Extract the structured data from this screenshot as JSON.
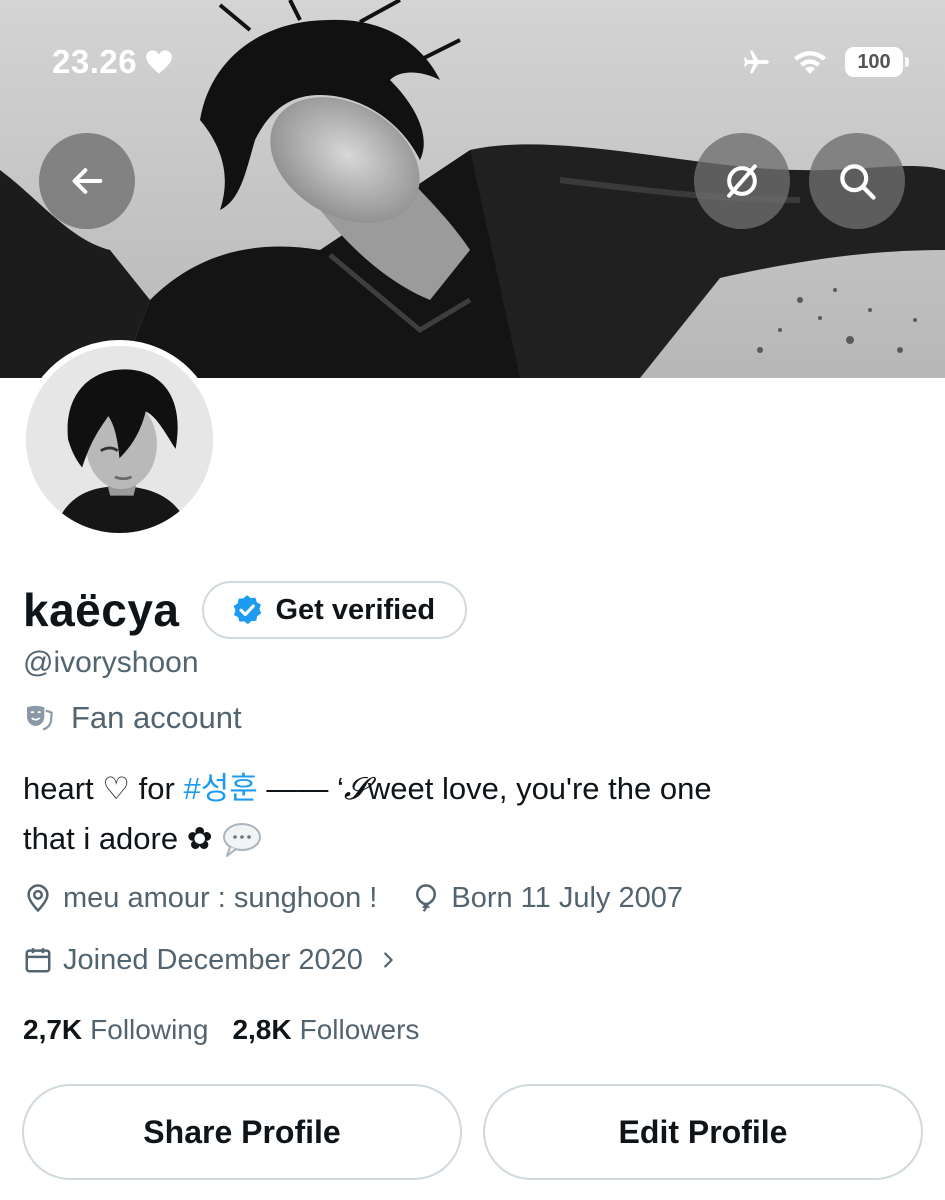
{
  "status_bar": {
    "time": "23.26",
    "heart_icon": "heart-icon",
    "airplane_icon": "airplane-icon",
    "wifi_icon": "wifi-icon",
    "battery_level": "100"
  },
  "header": {
    "back_icon": "arrow-left-icon",
    "translate_icon": "translate-slash-icon",
    "search_icon": "search-icon"
  },
  "profile": {
    "display_name": "kaëcya",
    "verify_label": "Get verified",
    "handle": "@ivoryshoon",
    "category": "Fan account",
    "bio": {
      "part1": "heart ♡ for ",
      "hashtag": "#성훈",
      "part2": " —— ‘",
      "script_letter": "𝓢",
      "part3": "weet love, you're the one that i adore ✿ ",
      "speech_icon": "speech-bubble-icon"
    },
    "location": "meu amour  :  sunghoon !",
    "birthday": "Born 11 July 2007",
    "joined": "Joined December 2020",
    "following_count": "2,7K",
    "following_label": "Following",
    "followers_count": "2,8K",
    "followers_label": "Followers"
  },
  "actions": {
    "share_label": "Share Profile",
    "edit_label": "Edit Profile"
  },
  "colors": {
    "accent": "#1d9bf0",
    "secondary_text": "#536471",
    "primary_text": "#0f1419",
    "border": "#cfd9de"
  }
}
